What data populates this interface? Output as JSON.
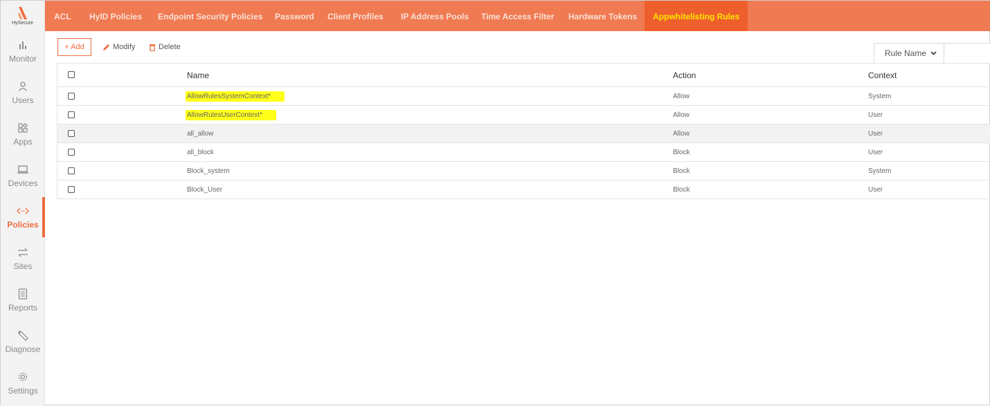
{
  "app": {
    "logo_text": "HySecure",
    "brand_color": "#f07a52",
    "accent_color": "#ee6d3e",
    "active_tab_text_color": "#ffe600",
    "highlight_color": "#ffff1a"
  },
  "sidebar": {
    "items": [
      {
        "label": "Monitor",
        "icon": "bar-chart-icon",
        "active": false
      },
      {
        "label": "Users",
        "icon": "user-icon",
        "active": false
      },
      {
        "label": "Apps",
        "icon": "apps-grid-icon",
        "active": false
      },
      {
        "label": "Devices",
        "icon": "laptop-icon",
        "active": false
      },
      {
        "label": "Policies",
        "icon": "code-arrows-icon",
        "active": true
      },
      {
        "label": "Sites",
        "icon": "swap-arrows-icon",
        "active": false
      },
      {
        "label": "Reports",
        "icon": "report-icon",
        "active": false
      },
      {
        "label": "Diagnose",
        "icon": "wrench-icon",
        "active": false
      },
      {
        "label": "Settings",
        "icon": "gear-icon",
        "active": false
      }
    ]
  },
  "tabs": [
    {
      "label": "ACL",
      "active": false
    },
    {
      "label": "HyID Policies",
      "active": false
    },
    {
      "label": "Endpoint Security Policies",
      "active": false
    },
    {
      "label": "Password",
      "active": false
    },
    {
      "label": "Client Profiles",
      "active": false
    },
    {
      "label": "IP Address Pools",
      "active": false
    },
    {
      "label": "Time Access Filter",
      "active": false
    },
    {
      "label": "Hardware Tokens",
      "active": false
    },
    {
      "label": "Appwhitelisting Rules",
      "active": true
    }
  ],
  "toolbar": {
    "add_label": "+ Add",
    "modify_label": "Modify",
    "delete_label": "Delete",
    "filter_selected": "Rule Name"
  },
  "table": {
    "columns": [
      "Name",
      "Action",
      "Context"
    ],
    "rows": [
      {
        "name": "AllowRulesSystemContext*",
        "action": "Allow",
        "context": "System",
        "highlighted": true
      },
      {
        "name": "AllowRulesUserContext*",
        "action": "Allow",
        "context": "User",
        "highlighted": true
      },
      {
        "name": "all_allow",
        "action": "Allow",
        "context": "User",
        "highlighted": false
      },
      {
        "name": "all_block",
        "action": "Block",
        "context": "User",
        "highlighted": false
      },
      {
        "name": "Block_system",
        "action": "Block",
        "context": "System",
        "highlighted": false
      },
      {
        "name": "Block_User",
        "action": "Block",
        "context": "User",
        "highlighted": false
      }
    ]
  }
}
